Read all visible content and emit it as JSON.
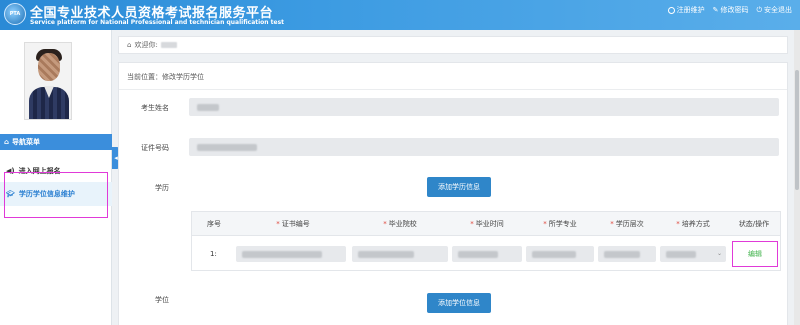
{
  "header": {
    "logo_text": "PTA",
    "title_cn": "全国专业技术人员资格考试报名服务平台",
    "title_en": "Service platform for National Professional and technician qualification test",
    "links": [
      {
        "label": "注册维护",
        "icon": "info-icon"
      },
      {
        "label": "修改密码",
        "icon": "edit-icon"
      },
      {
        "label": "安全退出",
        "icon": "power-icon"
      }
    ]
  },
  "sidebar": {
    "menu_title": "导航菜单",
    "collapse_glyph": "◂",
    "items": [
      {
        "label": "进入网上报名",
        "icon": "volume-icon"
      },
      {
        "label": "学历学位信息维护",
        "icon": "graduation-cap-icon",
        "active": true
      }
    ]
  },
  "welcome": {
    "label": "欢迎你:"
  },
  "main": {
    "breadcrumb": "当前位置：修改学历学位",
    "fields": {
      "name_label": "考生姓名",
      "id_label": "证件号码"
    },
    "education": {
      "label": "学历",
      "add_button": "添加学历信息",
      "table": {
        "headers": [
          {
            "text": "序号",
            "required": false
          },
          {
            "text": "证书编号",
            "required": true
          },
          {
            "text": "毕业院校",
            "required": true
          },
          {
            "text": "毕业时间",
            "required": true
          },
          {
            "text": "所学专业",
            "required": true
          },
          {
            "text": "学历层次",
            "required": true
          },
          {
            "text": "培养方式",
            "required": true
          },
          {
            "text": "状态/操作",
            "required": false
          }
        ],
        "rows": [
          {
            "no": "1",
            "action": "编辑"
          }
        ]
      }
    },
    "degree": {
      "label": "学位",
      "add_button": "添加学位信息"
    }
  },
  "colors": {
    "header_blue": "#3c9be2",
    "button_blue": "#2f86c9",
    "highlight_magenta": "#e03ad8",
    "edit_green": "#3fb24a"
  }
}
